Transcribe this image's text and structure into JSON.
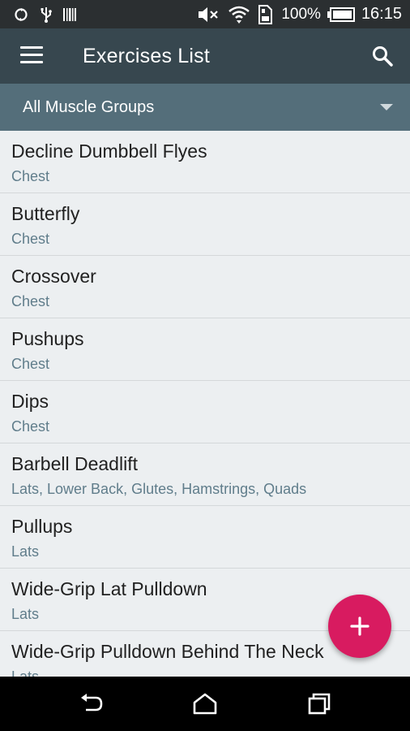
{
  "status_bar": {
    "battery": "100%",
    "time": "16:15"
  },
  "app_bar": {
    "title": "Exercises List",
    "menu_icon": "hamburger-menu-icon",
    "search_icon": "search-icon"
  },
  "filter": {
    "selected": "All Muscle Groups"
  },
  "exercises": [
    {
      "name": "Decline Dumbbell Flyes",
      "muscles": "Chest"
    },
    {
      "name": "Butterfly",
      "muscles": "Chest"
    },
    {
      "name": "Crossover",
      "muscles": "Chest"
    },
    {
      "name": "Pushups",
      "muscles": "Chest"
    },
    {
      "name": "Dips",
      "muscles": "Chest"
    },
    {
      "name": "Barbell Deadlift",
      "muscles": "Lats, Lower Back, Glutes, Hamstrings, Quads"
    },
    {
      "name": "Pullups",
      "muscles": "Lats"
    },
    {
      "name": "Wide-Grip Lat Pulldown",
      "muscles": "Lats"
    },
    {
      "name": "Wide-Grip Pulldown Behind The Neck",
      "muscles": "Lats"
    }
  ],
  "colors": {
    "status_bar": "#2b2f31",
    "app_bar": "#37474f",
    "filter_bar": "#546e7a",
    "list_bg": "#eceff1",
    "fab": "#d81b60",
    "subtitle": "#607d8b"
  }
}
